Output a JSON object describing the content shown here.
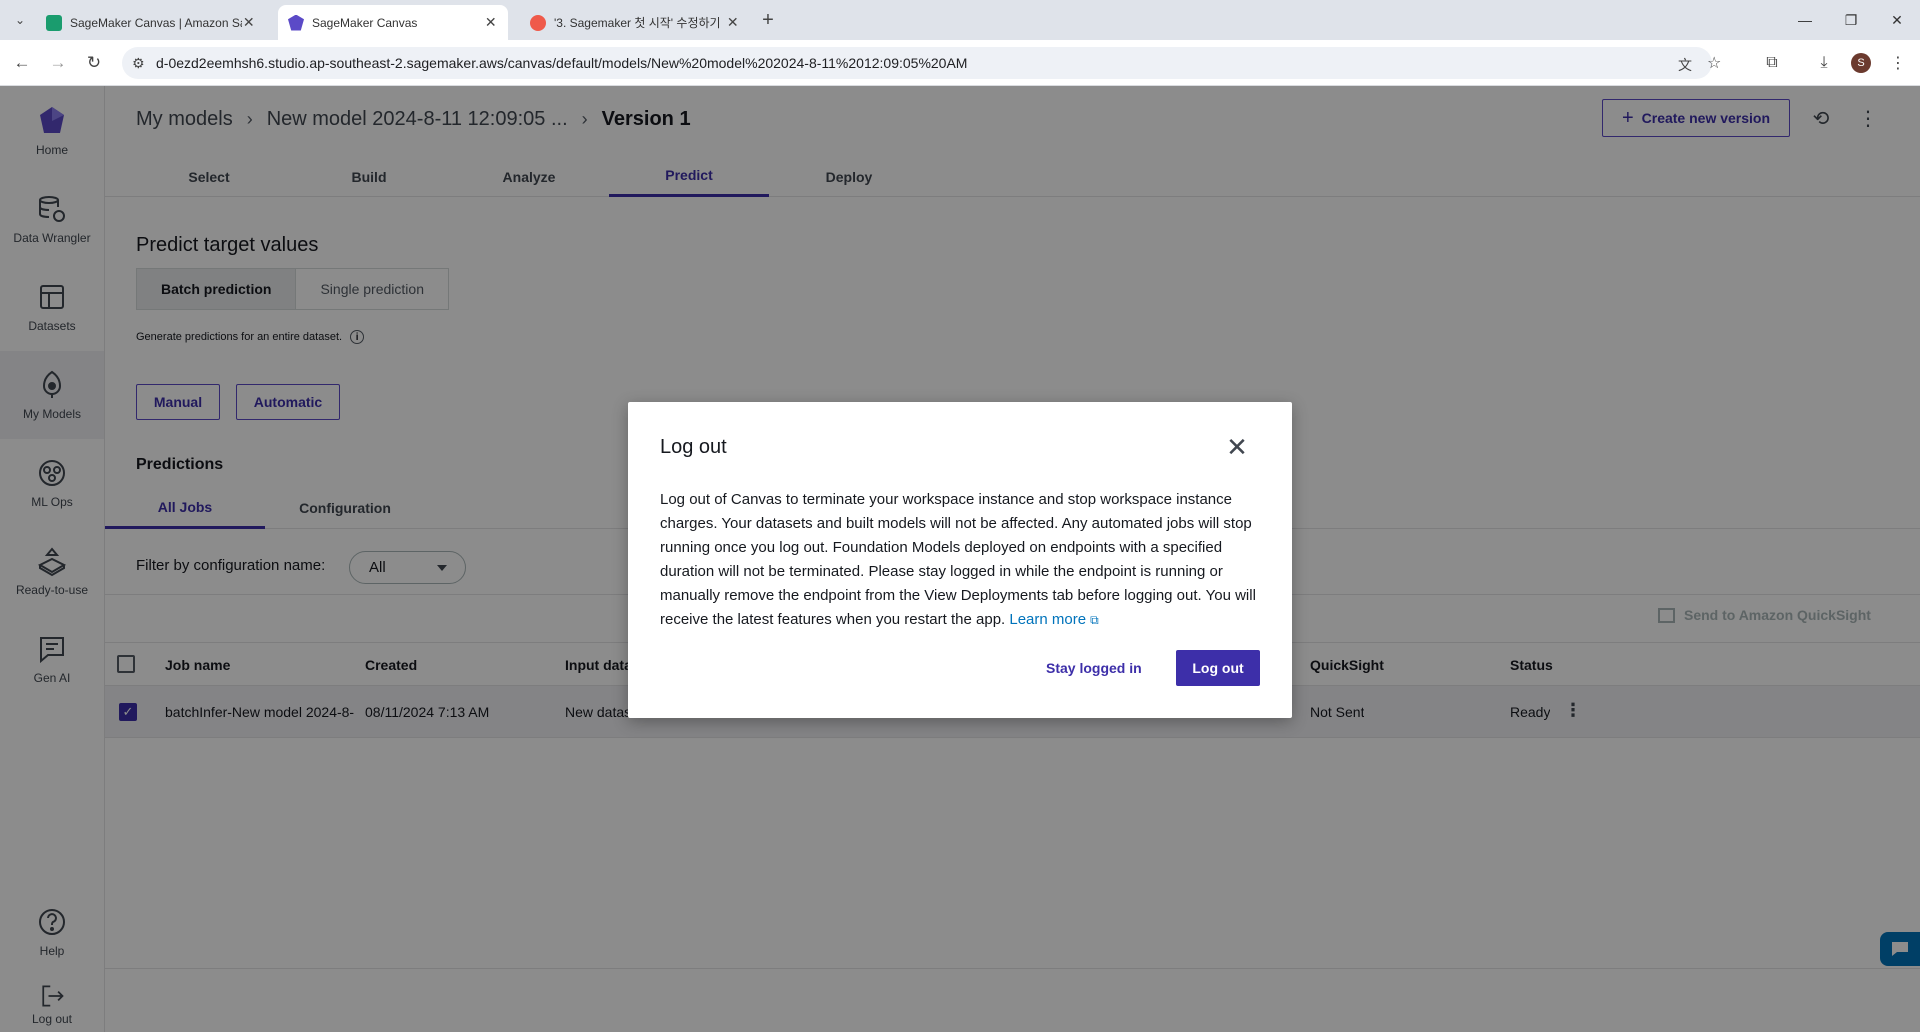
{
  "browser": {
    "tabs": [
      {
        "title": "SageMaker Canvas | Amazon Sa",
        "active": false
      },
      {
        "title": "SageMaker Canvas",
        "active": true
      },
      {
        "title": "'3. Sagemaker 첫 시작' 수정하기",
        "active": false
      }
    ],
    "new_tab_label": "+",
    "url": "d-0ezd2eemhsh6.studio.ap-southeast-2.sagemaker.aws/canvas/default/models/New%20model%202024-8-11%2012:09:05%20AM",
    "profile_initial": "S"
  },
  "sidebar": {
    "items": [
      {
        "label": "Home",
        "icon": "canvas-logo-icon"
      },
      {
        "label": "Data Wrangler",
        "icon": "data-wrangler-icon"
      },
      {
        "label": "Datasets",
        "icon": "datasets-icon"
      },
      {
        "label": "My Models",
        "icon": "models-icon"
      },
      {
        "label": "ML Ops",
        "icon": "ml-ops-icon"
      },
      {
        "label": "Ready-to-use",
        "icon": "ready-to-use-icon"
      },
      {
        "label": "Gen AI",
        "icon": "gen-ai-icon"
      },
      {
        "label": "Help",
        "icon": "help-icon"
      },
      {
        "label": "Log out",
        "icon": "log-out-icon"
      }
    ]
  },
  "header": {
    "breadcrumb": [
      "My models",
      "New model 2024-8-11 12:09:05 ...",
      "Version 1"
    ],
    "create_version_label": "Create new version"
  },
  "steps": [
    "Select",
    "Build",
    "Analyze",
    "Predict",
    "Deploy"
  ],
  "active_step": "Predict",
  "predict": {
    "title": "Predict target values",
    "modes": [
      "Batch prediction",
      "Single prediction"
    ],
    "hint": "Generate predictions for an entire dataset.",
    "manual_label": "Manual",
    "automatic_label": "Automatic",
    "predictions_title": "Predictions",
    "subtabs": [
      "All Jobs",
      "Configuration"
    ],
    "filter_label": "Filter by configuration name:",
    "filter_value": "All",
    "quicksight_label": "Send to Amazon QuickSight"
  },
  "table": {
    "columns": [
      "Job name",
      "Created",
      "Input data",
      "QuickSight",
      "Status"
    ],
    "rows": [
      {
        "job_name": "batchInfer-New model 2024-8-",
        "created": "08/11/2024 7:13 AM",
        "input_data": "New datas",
        "quicksight": "Not Sent",
        "status": "Ready",
        "checked": true
      }
    ]
  },
  "modal": {
    "title": "Log out",
    "body": "Log out of Canvas to terminate your workspace instance and stop workspace instance charges. Your datasets and built models will not be affected. Any automated jobs will stop running once you log out. Foundation Models deployed on endpoints with a specified duration will not be terminated. Please stay logged in while the endpoint is running or manually remove the endpoint from the View Deployments tab before logging out. You will receive the latest features when you restart the app.",
    "learn_more": "Learn more",
    "stay_label": "Stay logged in",
    "logout_label": "Log out"
  },
  "colors": {
    "accent": "#3d2fa9",
    "link": "#0073bb",
    "overlay": "rgba(0,0,0,0.45)"
  }
}
